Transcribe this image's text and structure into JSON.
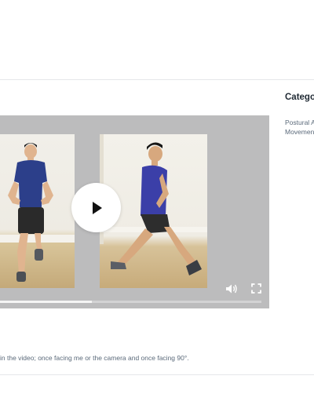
{
  "sidebar": {
    "heading": "Categor",
    "items": [
      "Postural A",
      "Movemen"
    ]
  },
  "video": {
    "buffered_fraction": 0.35,
    "controls": {
      "play_icon": "play-icon",
      "volume_icon": "volume-icon",
      "fullscreen_icon": "fullscreen-icon"
    }
  },
  "description": {
    "text": "in the video; once facing me or the camera and once facing 90°."
  },
  "colors": {
    "video_background": "#bcbcbd",
    "divider": "#e5e7ea",
    "heading_text": "#1f2933",
    "body_text": "#5b6a7a"
  }
}
